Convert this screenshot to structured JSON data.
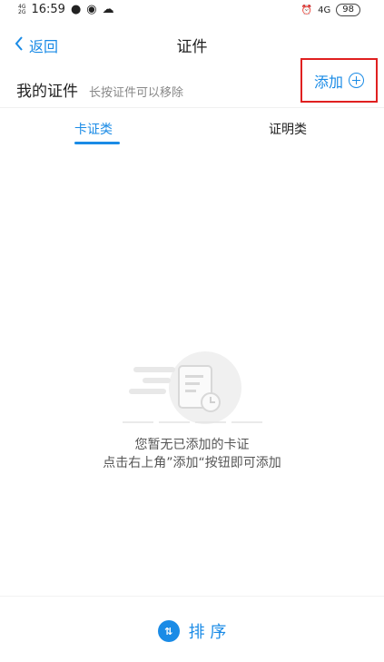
{
  "status_bar": {
    "signal1": "4G",
    "signal2": "2G",
    "time": "16:59",
    "network": "4G",
    "battery": "98"
  },
  "navbar": {
    "back_label": "返回",
    "title": "证件"
  },
  "my_certs": {
    "heading": "我的证件",
    "hint": "长按证件可以移除",
    "add_label": "添加"
  },
  "tabs": [
    {
      "label": "卡证类",
      "active": true
    },
    {
      "label": "证明类",
      "active": false
    }
  ],
  "empty_state": {
    "line1": "您暂无已添加的卡证",
    "line2": "点击右上角”添加“按钮即可添加"
  },
  "bottom": {
    "sort_label": "排 序"
  },
  "colors": {
    "accent": "#1a8be6",
    "highlight_box": "#e02020"
  }
}
